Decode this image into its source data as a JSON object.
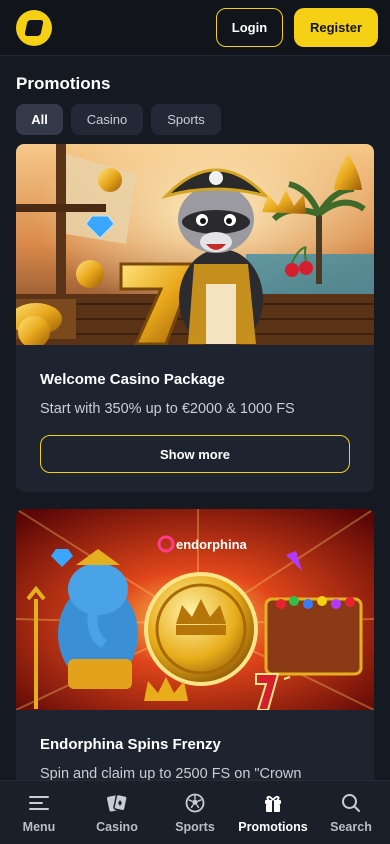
{
  "header": {
    "logo_icon": "brand-logo-icon",
    "login_label": "Login",
    "register_label": "Register",
    "accent_color": "#f5d015"
  },
  "page": {
    "title": "Promotions"
  },
  "tabs": [
    {
      "label": "All",
      "active": true
    },
    {
      "label": "Casino",
      "active": false
    },
    {
      "label": "Sports",
      "active": false
    }
  ],
  "promotions": [
    {
      "title": "Welcome Casino Package",
      "description": "Start with 350% up to €2000 & 1000 FS",
      "button_label": "Show more",
      "image": "pirate-raccoon-banner"
    },
    {
      "title": "Endorphina Spins Frenzy",
      "description": "Spin and claim up to 2500 FS on \"Crown",
      "image": "endorphina-ganesha-banner",
      "image_brand_text": "endorphina"
    }
  ],
  "bottom_nav": [
    {
      "label": "Menu",
      "icon": "menu-icon",
      "active": false
    },
    {
      "label": "Casino",
      "icon": "casino-cards-icon",
      "active": false
    },
    {
      "label": "Sports",
      "icon": "soccer-ball-icon",
      "active": false
    },
    {
      "label": "Promotions",
      "icon": "gift-icon",
      "active": true
    },
    {
      "label": "Search",
      "icon": "search-icon",
      "active": false
    }
  ]
}
